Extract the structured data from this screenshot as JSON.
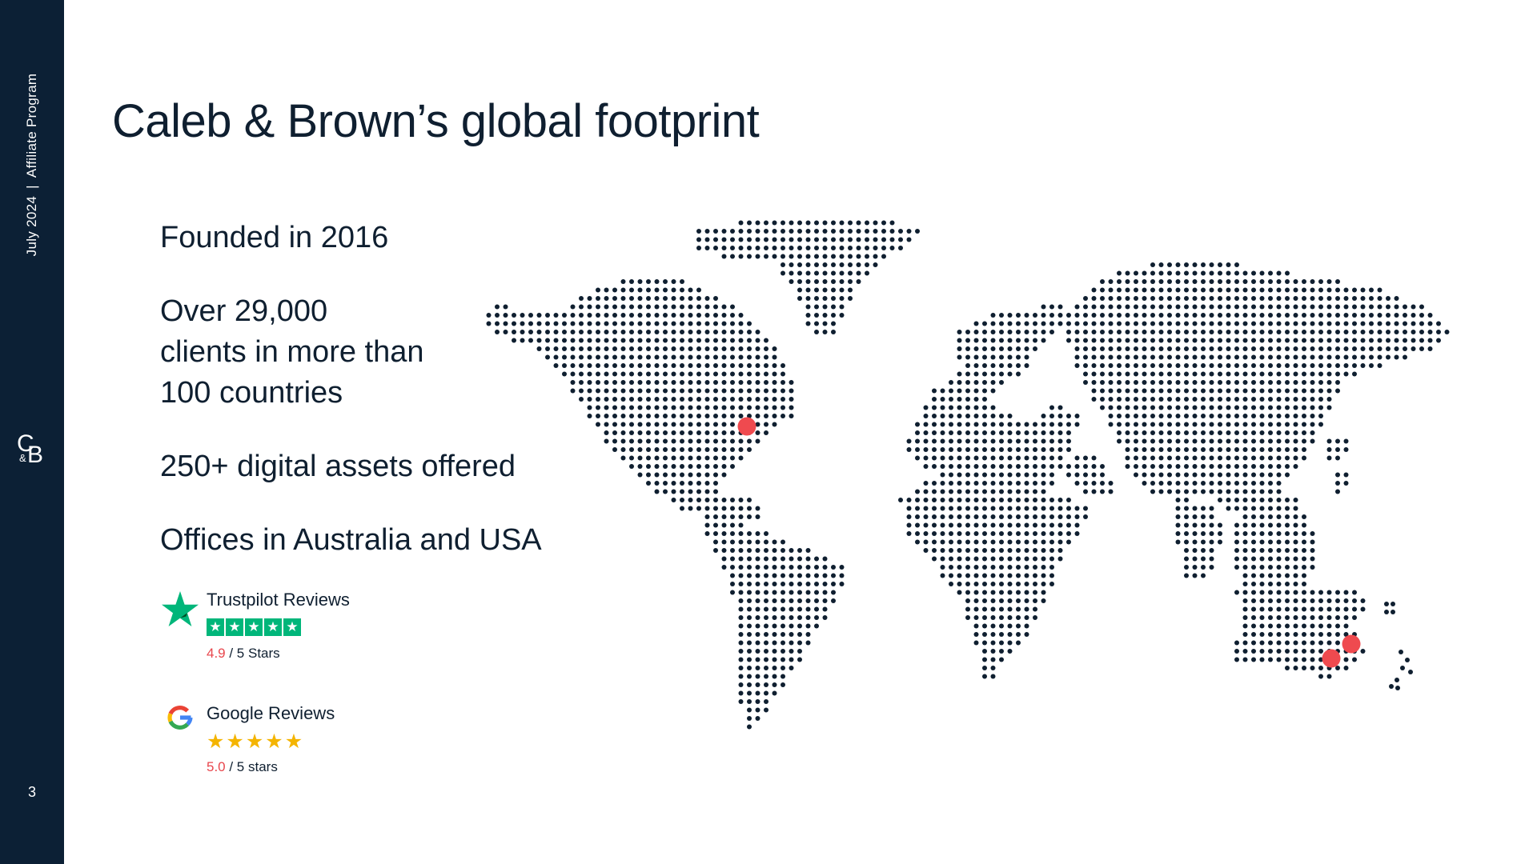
{
  "sidebar": {
    "caption_date": "July 2024",
    "caption_separator": "|",
    "caption_program": "Affiliate Program",
    "logo_text": "C&B",
    "logo_c": "C",
    "logo_amp": "&",
    "logo_b": "B",
    "page_number": "3"
  },
  "title": "Caleb & Brown’s global footprint",
  "facts": [
    "Founded in 2016",
    "Over 29,000\nclients in more than\n100 countries",
    "250+ digital assets offered",
    "Offices in Australia and USA"
  ],
  "reviews": {
    "trustpilot": {
      "icon": "trustpilot-star-icon",
      "name": "Trustpilot Reviews",
      "score": "4.9",
      "suffix": " / 5 Stars",
      "stars": 5,
      "color": "#00b67a"
    },
    "google": {
      "icon": "google-g-icon",
      "name": "Google Reviews",
      "score": "5.0",
      "suffix": " / 5 stars",
      "stars": 5,
      "color": "#f4b400"
    }
  },
  "map": {
    "dot_color": "#0f1f30",
    "marker_color": "#ef4a4f",
    "markers": [
      "office-marker-usa",
      "office-marker-sydney",
      "office-marker-melbourne"
    ]
  },
  "colors": {
    "sidebar": "#0c2035",
    "text": "#0f1f30",
    "accent_red": "#e8464c"
  }
}
